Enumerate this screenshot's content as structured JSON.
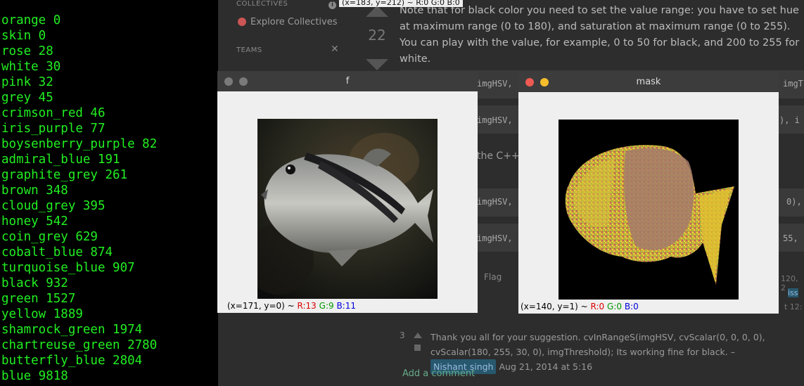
{
  "terminal": {
    "lines": [
      "orange 0",
      "skin 0",
      "rose 28",
      "white 30",
      "pink 32",
      "grey 45",
      "crimson_red 46",
      "iris_purple 77",
      "boysenberry_purple 82",
      "admiral_blue 191",
      "graphite_grey 261",
      "brown 348",
      "cloud_grey 395",
      "honey 542",
      "coin_grey 629",
      "cobalt_blue 874",
      "turquoise_blue 907",
      "black 932",
      "green 1527",
      "yellow 1889",
      "shamrock_green 1974",
      "chartreuse_green 2780",
      "butterfly_blue 2804",
      "blue 9818"
    ],
    "text_color": "#22ee22"
  },
  "browser": {
    "sidebar": {
      "collectives_label": "COLLECTIVES",
      "explore_link": "Explore Collectives",
      "teams_label": "TEAMS",
      "info_icon": "i",
      "close_icon": "✕"
    },
    "vote_count": "22",
    "coord_tooltip": "(x=183, y=212) ~ R:0 G:0 B:0",
    "answer_text": "Note that for black color you need to set the value range: you have to set hue at maximum range (0 to 180), and saturation at maximum range (0 to 255). You can play with the value, for example, 0 to 50 for black, and 200 to 255 for white.",
    "code_lines": {
      "code1": "imgHSV,",
      "code1_right": "imgT",
      "code2": "imgHSV,",
      "code2_right": "), i",
      "code3": "imgHSV,",
      "code3_right": "0),",
      "code4": "imgHSV,",
      "code4_right": "55,"
    },
    "para_fragment": "the C++ i",
    "flag_label": "Flag",
    "right_fragments": {
      "a": "120, 2",
      "b": "iss",
      "c": "t 12:"
    },
    "comment": {
      "number": "3",
      "text": "Thank you all for your suggestion. cvInRangeS(imgHSV, cvScalar(0, 0, 0, 0), cvScalar(180, 255, 30, 0), imgThreshold); Its working fine for black. –",
      "user": "Nishant singh",
      "date": "Aug 21, 2014 at 5:16"
    },
    "add_comment": "Add a comment"
  },
  "window_f": {
    "title": "f",
    "status_coords": "(x=171, y=0) ~ ",
    "status_r": "R:13",
    "status_g": "G:9",
    "status_b": "B:11",
    "image_desc_name": "fish-photo"
  },
  "window_mask": {
    "title": "mask",
    "status_coords": "(x=140, y=1) ~ ",
    "status_r": "R:0",
    "status_g": "G:0",
    "status_b": "B:0"
  },
  "colors": {
    "close_red": "#ee5a52",
    "minimize_yellow": "#f5bd2c",
    "inactive_grey": "#7a7a7a",
    "titlebar": "#3c3c3c"
  }
}
